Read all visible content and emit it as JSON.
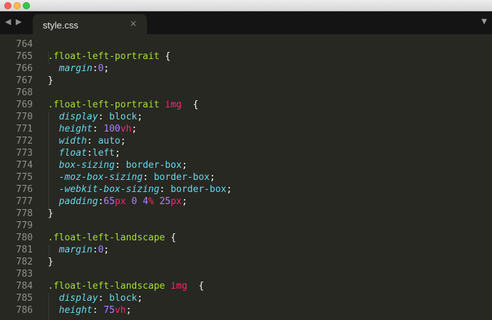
{
  "tabs": [
    {
      "label": "style.css",
      "close_icon": "×"
    }
  ],
  "gutter_lines": [
    "764",
    "765",
    "766",
    "767",
    "768",
    "769",
    "770",
    "771",
    "772",
    "773",
    "774",
    "775",
    "776",
    "777",
    "778",
    "779",
    "780",
    "781",
    "782",
    "783",
    "784",
    "785",
    "786"
  ],
  "code_lines": [
    [],
    [
      {
        "t": ".float-left-portrait",
        "c": "sel"
      },
      {
        "t": " {",
        "c": "punc"
      }
    ],
    [
      {
        "t": "  ",
        "c": "punc"
      },
      {
        "t": "margin",
        "c": "prop"
      },
      {
        "t": ":",
        "c": "punc"
      },
      {
        "t": "0",
        "c": "num"
      },
      {
        "t": ";",
        "c": "punc"
      }
    ],
    [
      {
        "t": "}",
        "c": "punc"
      }
    ],
    [],
    [
      {
        "t": ".float-left-portrait",
        "c": "sel"
      },
      {
        "t": " ",
        "c": "punc"
      },
      {
        "t": "img",
        "c": "tag"
      },
      {
        "t": "  {",
        "c": "punc"
      }
    ],
    [
      {
        "t": "  ",
        "c": "punc"
      },
      {
        "t": "display",
        "c": "prop"
      },
      {
        "t": ": ",
        "c": "punc"
      },
      {
        "t": "block",
        "c": "val"
      },
      {
        "t": ";",
        "c": "punc"
      }
    ],
    [
      {
        "t": "  ",
        "c": "punc"
      },
      {
        "t": "height",
        "c": "prop"
      },
      {
        "t": ": ",
        "c": "punc"
      },
      {
        "t": "100",
        "c": "num"
      },
      {
        "t": "vh",
        "c": "unit"
      },
      {
        "t": ";",
        "c": "punc"
      }
    ],
    [
      {
        "t": "  ",
        "c": "punc"
      },
      {
        "t": "width",
        "c": "prop"
      },
      {
        "t": ": ",
        "c": "punc"
      },
      {
        "t": "auto",
        "c": "val"
      },
      {
        "t": ";",
        "c": "punc"
      }
    ],
    [
      {
        "t": "  ",
        "c": "punc"
      },
      {
        "t": "float",
        "c": "prop"
      },
      {
        "t": ":",
        "c": "punc"
      },
      {
        "t": "left",
        "c": "val"
      },
      {
        "t": ";",
        "c": "punc"
      }
    ],
    [
      {
        "t": "  ",
        "c": "punc"
      },
      {
        "t": "box-sizing",
        "c": "prop"
      },
      {
        "t": ": ",
        "c": "punc"
      },
      {
        "t": "border-box",
        "c": "val"
      },
      {
        "t": ";",
        "c": "punc"
      }
    ],
    [
      {
        "t": "  ",
        "c": "punc"
      },
      {
        "t": "-moz-box-sizing",
        "c": "prop"
      },
      {
        "t": ": ",
        "c": "punc"
      },
      {
        "t": "border-box",
        "c": "val"
      },
      {
        "t": ";",
        "c": "punc"
      }
    ],
    [
      {
        "t": "  ",
        "c": "punc"
      },
      {
        "t": "-webkit-box-sizing",
        "c": "prop"
      },
      {
        "t": ": ",
        "c": "punc"
      },
      {
        "t": "border-box",
        "c": "val"
      },
      {
        "t": ";",
        "c": "punc"
      }
    ],
    [
      {
        "t": "  ",
        "c": "punc"
      },
      {
        "t": "padding",
        "c": "prop"
      },
      {
        "t": ":",
        "c": "punc"
      },
      {
        "t": "65",
        "c": "num"
      },
      {
        "t": "px",
        "c": "unit"
      },
      {
        "t": " ",
        "c": "punc"
      },
      {
        "t": "0",
        "c": "num"
      },
      {
        "t": " ",
        "c": "punc"
      },
      {
        "t": "4",
        "c": "num"
      },
      {
        "t": "%",
        "c": "unit"
      },
      {
        "t": " ",
        "c": "punc"
      },
      {
        "t": "25",
        "c": "num"
      },
      {
        "t": "px",
        "c": "unit"
      },
      {
        "t": ";",
        "c": "punc"
      }
    ],
    [
      {
        "t": "}",
        "c": "punc"
      }
    ],
    [],
    [
      {
        "t": ".float-left-landscape",
        "c": "sel"
      },
      {
        "t": " {",
        "c": "punc"
      }
    ],
    [
      {
        "t": "  ",
        "c": "punc"
      },
      {
        "t": "margin",
        "c": "prop"
      },
      {
        "t": ":",
        "c": "punc"
      },
      {
        "t": "0",
        "c": "num"
      },
      {
        "t": ";",
        "c": "punc"
      }
    ],
    [
      {
        "t": "}",
        "c": "punc"
      }
    ],
    [],
    [
      {
        "t": ".float-left-landscape",
        "c": "sel"
      },
      {
        "t": " ",
        "c": "punc"
      },
      {
        "t": "img",
        "c": "tag"
      },
      {
        "t": "  {",
        "c": "punc"
      }
    ],
    [
      {
        "t": "  ",
        "c": "punc"
      },
      {
        "t": "display",
        "c": "prop"
      },
      {
        "t": ": ",
        "c": "punc"
      },
      {
        "t": "block",
        "c": "val"
      },
      {
        "t": ";",
        "c": "punc"
      }
    ],
    [
      {
        "t": "  ",
        "c": "punc"
      },
      {
        "t": "height",
        "c": "prop"
      },
      {
        "t": ": ",
        "c": "punc"
      },
      {
        "t": "75",
        "c": "num"
      },
      {
        "t": "vh",
        "c": "unit"
      },
      {
        "t": ";",
        "c": "punc"
      }
    ]
  ],
  "icons": {
    "window_controls": [
      "close-light-icon",
      "minimize-light-icon",
      "maximize-light-icon"
    ],
    "nav": [
      "chevron-left-icon",
      "chevron-right-icon"
    ],
    "tab_menu": "triangle-down-icon"
  },
  "colors": {
    "background": "#272822",
    "tabbar": "#141414",
    "selector": "#a6e22e",
    "tag": "#f92672",
    "property": "#66d9ef",
    "number": "#ae81ff",
    "unit": "#f92672",
    "gutter": "#90908a"
  }
}
